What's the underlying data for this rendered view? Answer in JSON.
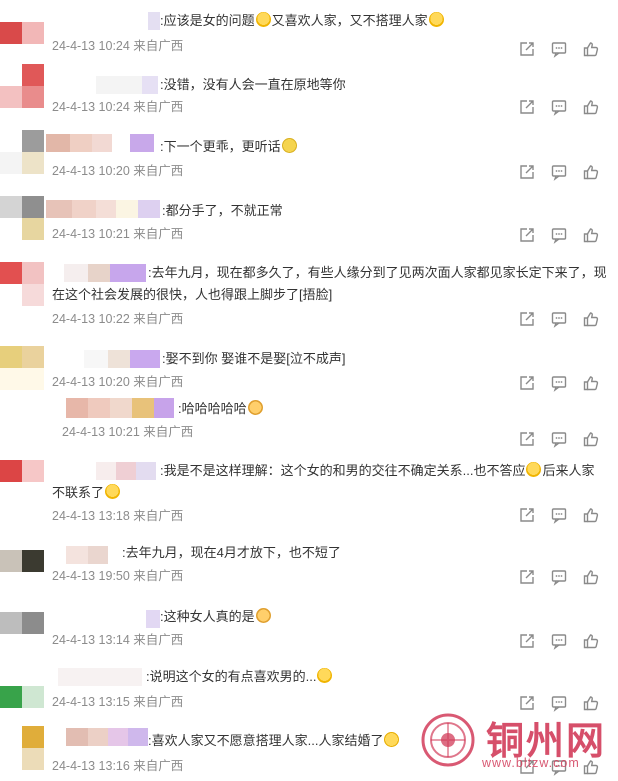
{
  "comments": [
    {
      "text_parts": [
        ":应该是女的问题",
        "又喜欢人家，又不搭理人家",
        ""
      ],
      "emojis": [
        "laugh",
        "laugh"
      ],
      "date": "24-4-13 10:24 来自广西"
    },
    {
      "text_parts": [
        ":没错，没有人会一直在原地等你"
      ],
      "emojis": [],
      "date": "24-4-13 10:24 来自广西"
    },
    {
      "text_parts": [
        ":下一个更乖，更听话",
        ""
      ],
      "emojis": [
        "yellow"
      ],
      "date": "24-4-13 10:20 来自广西"
    },
    {
      "text_parts": [
        ":都分手了，不就正常"
      ],
      "emojis": [],
      "date": "24-4-13 10:21 来自广西"
    },
    {
      "text_line1": ":去年九月，现在都多久了，有些人缘分到了见两次面人家都见家长定下来了，现",
      "text_line2": "在这个社会发展的很快，人也得跟上脚步了[捂脸]",
      "date": "24-4-13 10:22 来自广西"
    },
    {
      "text_parts": [
        ":娶不到你  娶谁不是娶[泣不成声]"
      ],
      "emojis": [],
      "date": "24-4-13 10:20 来自广西"
    },
    {
      "text_parts": [
        ":哈哈哈哈哈",
        ""
      ],
      "emojis": [
        "cat"
      ],
      "date": "24-4-13 10:21 来自广西"
    },
    {
      "text_line1_parts": [
        ":我是不是这样理解：这个女的和男的交往不确定关系...也不答应",
        "后来人家"
      ],
      "text_line2": "不联系了",
      "date": "24-4-13 13:18 来自广西"
    },
    {
      "text_parts": [
        ":去年九月，现在4月才放下，也不短了"
      ],
      "emojis": [],
      "date": "24-4-13 19:50 来自广西"
    },
    {
      "text_parts": [
        ":这种女人真的是",
        ""
      ],
      "emojis": [
        "cat"
      ],
      "date": "24-4-13 13:14 来自广西"
    },
    {
      "text_parts": [
        ":说明这个女的有点喜欢男的...",
        ""
      ],
      "emojis": [
        "laugh"
      ],
      "date": "24-4-13 13:15 来自广西"
    },
    {
      "text_parts": [
        ":喜欢人家又不愿意搭理人家...人家结婚了",
        ""
      ],
      "emojis": [
        "sad"
      ],
      "date": "24-4-13 13:16 来自广西"
    }
  ],
  "icons": {
    "share": "share-icon",
    "comment": "comment-icon",
    "like": "like-icon"
  },
  "watermark": {
    "title": "铜州网",
    "url": "www.bltzw.com"
  }
}
